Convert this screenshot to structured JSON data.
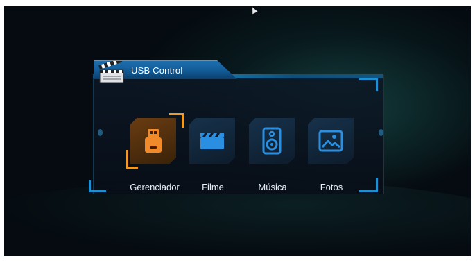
{
  "header": {
    "title": "USB Control"
  },
  "menu": {
    "items": [
      {
        "label": "Gerenciador",
        "icon": "usb-drive-icon",
        "selected": true
      },
      {
        "label": "Filme",
        "icon": "clapperboard-icon",
        "selected": false
      },
      {
        "label": "Música",
        "icon": "speaker-icon",
        "selected": false
      },
      {
        "label": "Fotos",
        "icon": "image-icon",
        "selected": false
      }
    ]
  },
  "colors": {
    "accent": "#1b8ac2",
    "selection": "#ee9a2a",
    "icon": "#2a8fe0"
  }
}
